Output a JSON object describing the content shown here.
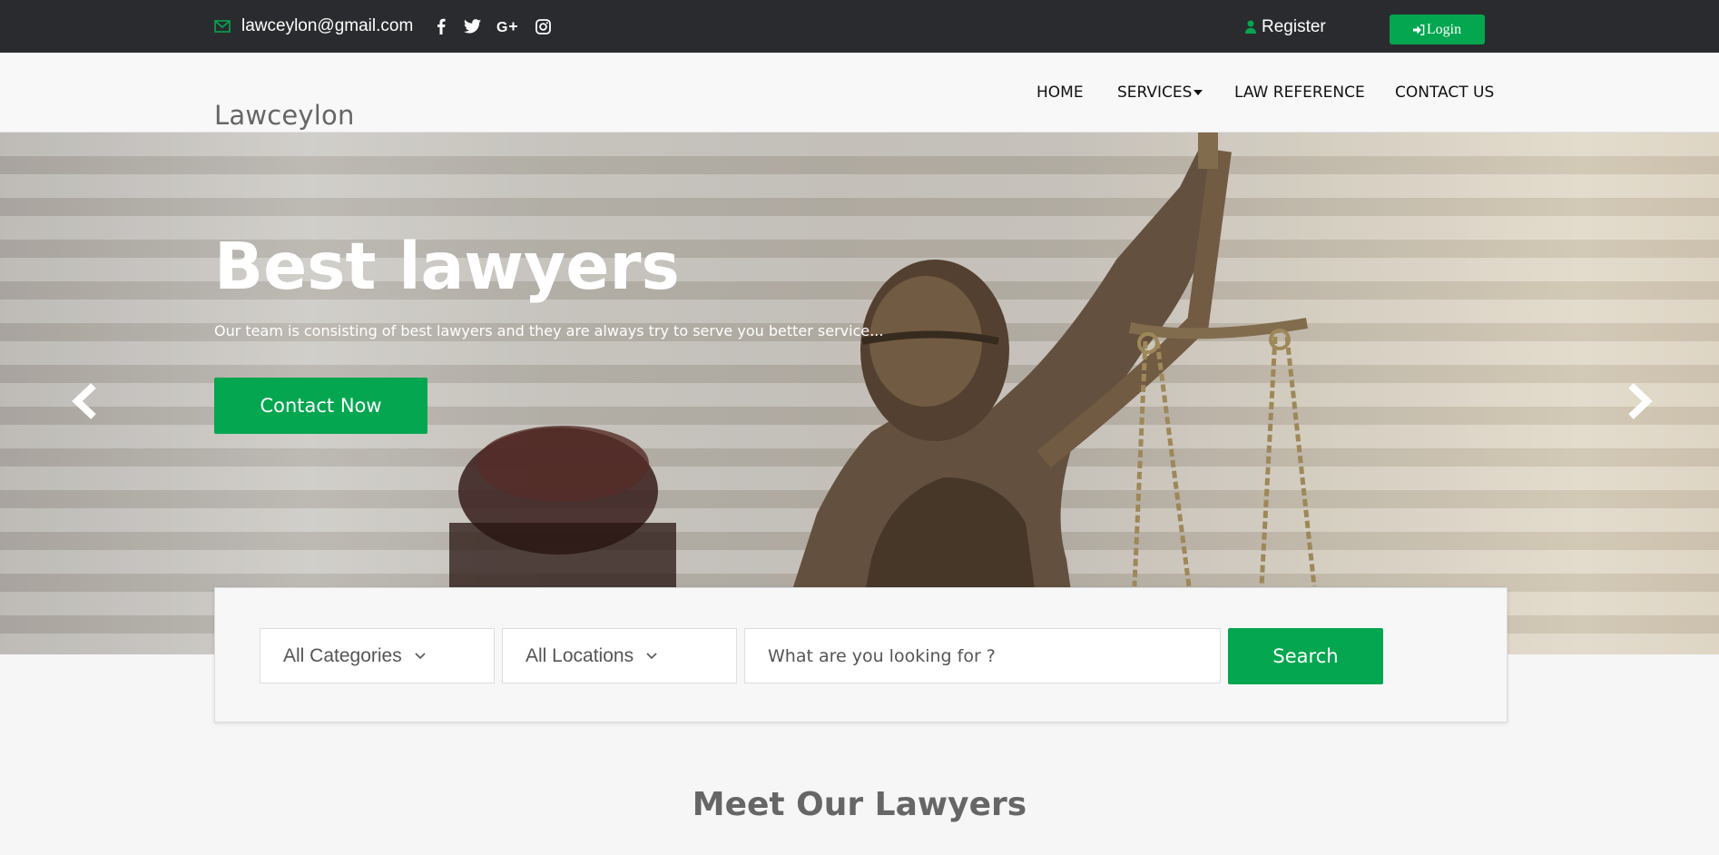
{
  "topbar": {
    "email": "lawceylon@gmail.com",
    "register_label": "Register",
    "login_label": "Login",
    "social_icons": [
      "facebook-icon",
      "twitter-icon",
      "google-plus-icon",
      "instagram-icon"
    ]
  },
  "header": {
    "brand": "Lawceylon",
    "nav": [
      {
        "label": "HOME"
      },
      {
        "label": "SERVICES"
      },
      {
        "label": "LAW REFERENCE"
      },
      {
        "label": "CONTACT US"
      }
    ]
  },
  "hero": {
    "title": "Best lawyers",
    "subtitle": "Our team is consisting of best lawyers and they are always try to serve you better service...",
    "cta_label": "Contact Now"
  },
  "search": {
    "category": "All Categories",
    "location": "All Locations",
    "placeholder": "What are you looking for ?",
    "button_label": "Search"
  },
  "section": {
    "title": "Meet Our Lawyers"
  },
  "colors": {
    "accent": "#04a650",
    "topbar_bg": "#2a2b2e",
    "header_bg": "#f8f8f8"
  }
}
